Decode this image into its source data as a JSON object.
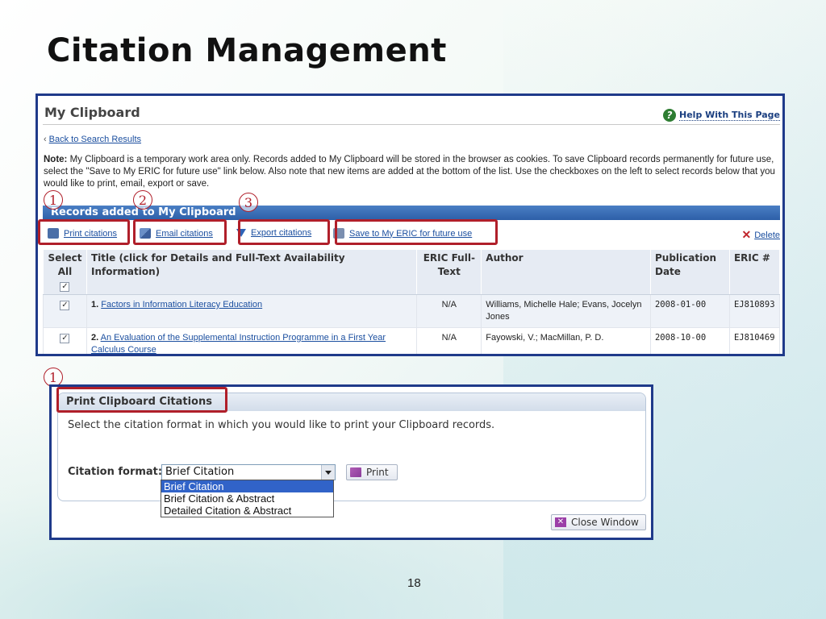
{
  "slide": {
    "title": "Citation Management",
    "page_number": "18"
  },
  "clipboard": {
    "title": "My Clipboard",
    "help_label": "Help With This Page",
    "back_link": "Back to Search Results",
    "note_label": "Note:",
    "note_text": " My Clipboard is a temporary work area only. Records added to My Clipboard will be stored in the browser as cookies. To save Clipboard records permanently for future use, select the \"Save to My ERIC for future use\" link below. Also note that new items are added at the bottom of the list. Use the checkboxes on the left to select records below that you would like to print, email, export or save.",
    "records_header": "Records added to My Clipboard",
    "toolbar": {
      "print": "Print citations",
      "email": "Email citations",
      "export": "Export citations",
      "save": "Save to My ERIC for future use",
      "delete": "Delete"
    },
    "columns": {
      "select_all": "Select All",
      "title": "Title (click for Details and Full-Text Availability Information)",
      "fulltext": "ERIC Full-Text",
      "author": "Author",
      "pubdate": "Publication Date",
      "ericnum": "ERIC #"
    },
    "rows": [
      {
        "num": "1.",
        "title": "Factors in Information Literacy Education",
        "fulltext": "N/A",
        "author": "Williams, Michelle Hale;  Evans, Jocelyn Jones",
        "date": "2008-01-00",
        "eric": "EJ810893",
        "checked": true
      },
      {
        "num": "2.",
        "title": "An Evaluation of the Supplemental Instruction Programme in a First Year Calculus Course",
        "fulltext": "N/A",
        "author": "Fayowski, V.;  MacMillan, P. D.",
        "date": "2008-10-00",
        "eric": "EJ810469",
        "checked": true
      }
    ]
  },
  "callouts": {
    "one": "1",
    "two": "2",
    "three": "3",
    "one_bottom": "1",
    "color": "#b01f2a"
  },
  "print_dialog": {
    "title": "Print Clipboard Citations",
    "description": "Select the citation format in which you would like to print your Clipboard records.",
    "format_label": "Citation format:",
    "selected_value": "Brief Citation",
    "print_button": "Print",
    "options": [
      "Brief Citation",
      "Brief Citation & Abstract",
      "Detailed Citation & Abstract"
    ],
    "close_button": "Close Window"
  },
  "icons": {
    "help": "help-icon",
    "print": "print-icon",
    "email": "email-icon",
    "export": "export-icon",
    "save": "save-icon",
    "delete": "delete-icon"
  }
}
